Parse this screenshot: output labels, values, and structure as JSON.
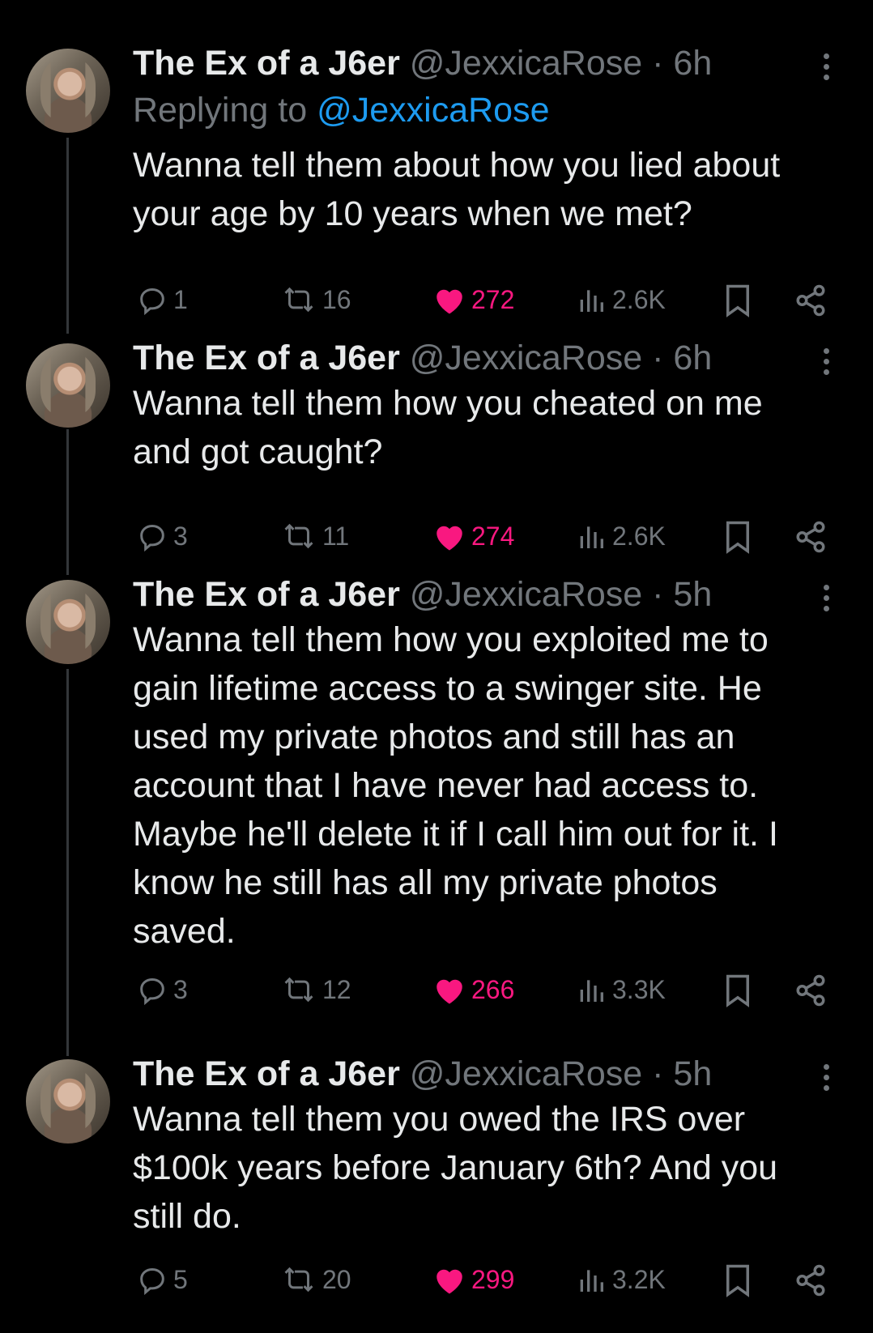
{
  "author": {
    "name": "The Ex of a J6er",
    "handle": "@JexxicaRose"
  },
  "tweets": [
    {
      "time": "6h",
      "replying_label": "Replying to ",
      "replying_to": "@JexxicaRose",
      "lines": [
        "Wanna tell them about how you lied about",
        "your age by 10 years when we met?"
      ],
      "replies": "1",
      "retweets": "16",
      "likes": "272",
      "views": "2.6K"
    },
    {
      "time": "6h",
      "lines": [
        "Wanna tell them how you cheated on me",
        "and got caught?"
      ],
      "replies": "3",
      "retweets": "11",
      "likes": "274",
      "views": "2.6K"
    },
    {
      "time": "5h",
      "lines": [
        "Wanna tell them how you exploited me to",
        "gain lifetime access to a swinger site. He",
        "used my private photos and still has an",
        "account that I have never had access to.",
        "Maybe he'll delete it if I call him out for it. I",
        "know he still has all my private photos",
        "saved."
      ],
      "replies": "3",
      "retweets": "12",
      "likes": "266",
      "views": "3.3K"
    },
    {
      "time": "5h",
      "lines": [
        "Wanna tell them you owed the IRS over",
        "$100k years before January 6th? And you",
        "still do."
      ],
      "replies": "5",
      "retweets": "20",
      "likes": "299",
      "views": "3.2K"
    }
  ],
  "separator": " · ",
  "icons": {
    "reply": "reply-icon",
    "retweet": "retweet-icon",
    "like": "heart-icon",
    "views": "views-icon",
    "bookmark": "bookmark-icon",
    "share": "share-icon",
    "more": "more-icon"
  },
  "colors": {
    "background": "#000000",
    "text": "#e7e9ea",
    "muted": "#71767b",
    "link": "#1d9bf0",
    "like": "#f91880"
  }
}
